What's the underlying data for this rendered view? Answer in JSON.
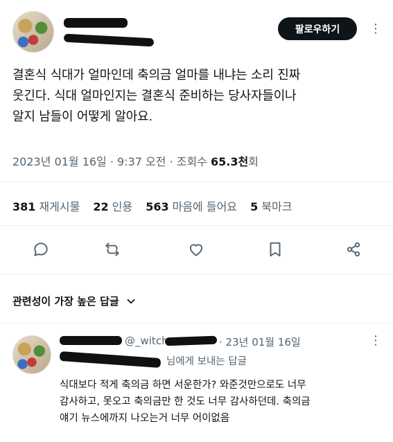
{
  "header": {
    "follow_label": "팔로우하기",
    "more_icon": "more-icon"
  },
  "tweet": {
    "lines": [
      "결혼식 식대가 얼마인데 축의금 얼마를 내냐는 소리 진짜",
      "웃긴다. 식대 얼마인지는 결혼식 준비하는 당사자들이나",
      "알지 남들이 어떻게 알아요."
    ],
    "date": "2023년 01월 16일 · 9:37 오전 · 조회수 ",
    "views": "65.3천",
    "views_suffix": "회"
  },
  "stats": {
    "retweets_num": "381",
    "retweets_label": "재게시물",
    "quotes_num": "22",
    "quotes_label": "인용",
    "likes_num": "563",
    "likes_label": "마음에 들어요",
    "bookmarks_num": "5",
    "bookmarks_label": "북마크"
  },
  "actions": [
    "reply-icon",
    "retweet-icon",
    "like-icon",
    "bookmark-icon",
    "share-icon"
  ],
  "sort": {
    "label": "관련성이 가장 높은 답글"
  },
  "reply": {
    "handle_partial": "@_witch",
    "date": "· 23년 01월 16일",
    "replying_to_suffix": "님에게 보내는 답글",
    "lines": [
      "식대보다 적게 축의금 하면 서운한가? 와준것만으로도 너무",
      "감사하고, 못오고 축의금만 한 것도 너무 감사하던데. 축의금",
      "얘기 뉴스에까지 나오는거 너무 어이없음"
    ]
  },
  "colors": {
    "text": "#0f1419",
    "secondary": "#536471",
    "divider": "#eff3f4",
    "button": "#0f1419"
  }
}
